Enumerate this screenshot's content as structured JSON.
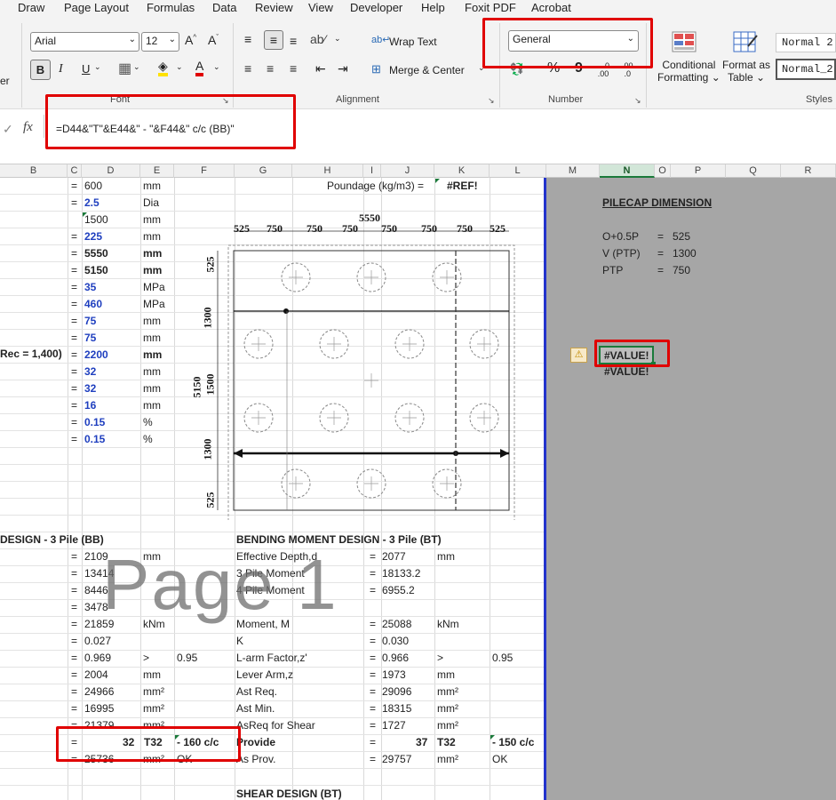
{
  "menu": [
    "Draw",
    "Page Layout",
    "Formulas",
    "Data",
    "Review",
    "View",
    "Developer",
    "Help",
    "Foxit PDF",
    "Acrobat"
  ],
  "ribbon": {
    "font_name": "Arial",
    "font_size": "12",
    "bold": "B",
    "italic": "I",
    "underline": "U",
    "font_group": "Font",
    "wrap_text": "Wrap Text",
    "merge_center": "Merge & Center",
    "alignment_group": "Alignment",
    "number_format": "General",
    "percent": "%",
    "comma": "9",
    "inc_decimal": ".00",
    "dec_decimal": ".0",
    "number_group": "Number",
    "conditional_formatting_1": "Conditional",
    "conditional_formatting_2": "Formatting",
    "format_as_table_1": "Format as",
    "format_as_table_2": "Table",
    "style_1": "Normal 2",
    "style_2": "Normal_2",
    "styles_group": "Styles",
    "left_cut": "er"
  },
  "formula_bar": {
    "fx": "fx",
    "formula": "=D44&\"T\"&E44&\" - \"&F44&\" c/c (BB)\""
  },
  "columns": [
    "B",
    "C",
    "D",
    "E",
    "F",
    "G",
    "H",
    "I",
    "J",
    "K",
    "L",
    "M",
    "N",
    "O",
    "P",
    "Q",
    "R"
  ],
  "left_rows": [
    {
      "eq": "=",
      "val": "600",
      "unit": "mm",
      "blue": false,
      "bold": false
    },
    {
      "eq": "=",
      "val": "2.5",
      "unit": "Dia",
      "blue": true,
      "bold": false
    },
    {
      "eq": "",
      "val": "1500",
      "unit": "mm",
      "blue": false,
      "bold": false
    },
    {
      "eq": "=",
      "val": "225",
      "unit": "mm",
      "blue": true,
      "bold": false
    },
    {
      "eq": "=",
      "val": "5550",
      "unit": "mm",
      "blue": false,
      "bold": true
    },
    {
      "eq": "=",
      "val": "5150",
      "unit": "mm",
      "blue": false,
      "bold": true
    },
    {
      "eq": "=",
      "val": "35",
      "unit": "MPa",
      "blue": true,
      "bold": false
    },
    {
      "eq": "=",
      "val": "460",
      "unit": "MPa",
      "blue": true,
      "bold": false
    },
    {
      "eq": "=",
      "val": "75",
      "unit": "mm",
      "blue": true,
      "bold": false
    },
    {
      "eq": "=",
      "val": "75",
      "unit": "mm",
      "blue": true,
      "bold": false
    },
    {
      "eq": "=",
      "val": "2200",
      "unit": "mm",
      "blue": true,
      "bold": true
    },
    {
      "eq": "=",
      "val": "32",
      "unit": "mm",
      "blue": true,
      "bold": false
    },
    {
      "eq": "=",
      "val": "32",
      "unit": "mm",
      "blue": true,
      "bold": false
    },
    {
      "eq": "=",
      "val": "16",
      "unit": "mm",
      "blue": true,
      "bold": false
    },
    {
      "eq": "=",
      "val": "0.15",
      "unit": "%",
      "blue": true,
      "bold": false
    },
    {
      "eq": "=",
      "val": "0.15",
      "unit": "%",
      "blue": true,
      "bold": false
    }
  ],
  "rec_label": "Rec = 1,400)",
  "poundage_label": "Poundage (kg/m3) =",
  "poundage_value": "#REF!",
  "drawing": {
    "top_total": "5550",
    "top_dims": [
      "525",
      "750",
      "750",
      "750",
      "750",
      "750",
      "750",
      "525"
    ],
    "left_total_a": "5150",
    "left_total_b": "1500",
    "left_dims": [
      "525",
      "1300",
      "1300",
      "525"
    ]
  },
  "bb": {
    "title": "DESIGN - 3 Pile (BB)",
    "rows": [
      {
        "eq": "=",
        "val": "2109",
        "unit": "mm",
        "extra": ""
      },
      {
        "eq": "=",
        "val": "13414",
        "unit": "",
        "extra": ""
      },
      {
        "eq": "=",
        "val": "8446",
        "unit": "",
        "extra": ""
      },
      {
        "eq": "=",
        "val": "3478",
        "unit": "",
        "extra": ""
      },
      {
        "eq": "=",
        "val": "21859",
        "unit": "kNm",
        "extra": ""
      },
      {
        "eq": "=",
        "val": "0.027",
        "unit": "",
        "extra": ""
      },
      {
        "eq": "=",
        "val": "0.969",
        "unit": ">",
        "extra": "0.95"
      },
      {
        "eq": "=",
        "val": "2004",
        "unit": "mm",
        "extra": ""
      },
      {
        "eq": "=",
        "val": "24966",
        "unit": "mm²",
        "extra": ""
      },
      {
        "eq": "=",
        "val": "16995",
        "unit": "mm²",
        "extra": ""
      },
      {
        "eq": "=",
        "val": "21379",
        "unit": "mm²",
        "extra": ""
      }
    ],
    "provide_eq": "=",
    "provide_num": "32",
    "provide_bar": "T32",
    "provide_spacing": "- 160 c/c",
    "prov_eq": "=",
    "prov_val": "25736",
    "prov_unit": "mm²",
    "prov_ok": "OK"
  },
  "bt": {
    "title": "BENDING MOMENT DESIGN - 3 Pile (BT)",
    "rows": [
      {
        "label": "Effective Depth,d",
        "eq": "=",
        "val": "2077",
        "unit": "mm",
        "extra": ""
      },
      {
        "label": "3 Pile Moment",
        "eq": "=",
        "val": "18133.2",
        "unit": "",
        "extra": ""
      },
      {
        "label": "4 Pile Moment",
        "eq": "=",
        "val": "6955.2",
        "unit": "",
        "extra": ""
      },
      {
        "label": "",
        "eq": "",
        "val": "",
        "unit": "",
        "extra": ""
      },
      {
        "label": "Moment, M",
        "eq": "=",
        "val": "25088",
        "unit": "kNm",
        "extra": ""
      },
      {
        "label": "K",
        "eq": "=",
        "val": "0.030",
        "unit": "",
        "extra": ""
      },
      {
        "label": "L-arm Factor,z'",
        "eq": "=",
        "val": "0.966",
        "unit": ">",
        "extra": "0.95"
      },
      {
        "label": "Lever Arm,z",
        "eq": "=",
        "val": "1973",
        "unit": "mm",
        "extra": ""
      },
      {
        "label": "Ast Req.",
        "eq": "=",
        "val": "29096",
        "unit": "mm²",
        "extra": ""
      },
      {
        "label": "Ast Min.",
        "eq": "=",
        "val": "18315",
        "unit": "mm²",
        "extra": ""
      },
      {
        "label": "AsReq for Shear",
        "eq": "=",
        "val": "1727",
        "unit": "mm²",
        "extra": ""
      }
    ],
    "provide_label": "Provide",
    "provide_eq": "=",
    "provide_num": "37",
    "provide_bar": "T32",
    "provide_spacing": "- 150 c/c",
    "prov_label": "As Prov.",
    "prov_eq": "=",
    "prov_val": "29757",
    "prov_unit": "mm²",
    "prov_ok": "OK"
  },
  "shear_title": "SHEAR DESIGN (BT)",
  "watermark": "Page 1",
  "pilecap": {
    "title": "PILECAP DIMENSION",
    "rows": [
      {
        "label": "O+0.5P",
        "eq": "=",
        "val": "525"
      },
      {
        "label": "V (PTP)",
        "eq": "=",
        "val": "1300"
      },
      {
        "label": "PTP",
        "eq": "=",
        "val": "750"
      }
    ],
    "error_1": "#VALUE!",
    "error_2": "#VALUE!"
  },
  "colors": {
    "accent_blue": "#1f3fbf",
    "highlight_red": "#e00000",
    "grey_area": "#a6a6a6"
  }
}
